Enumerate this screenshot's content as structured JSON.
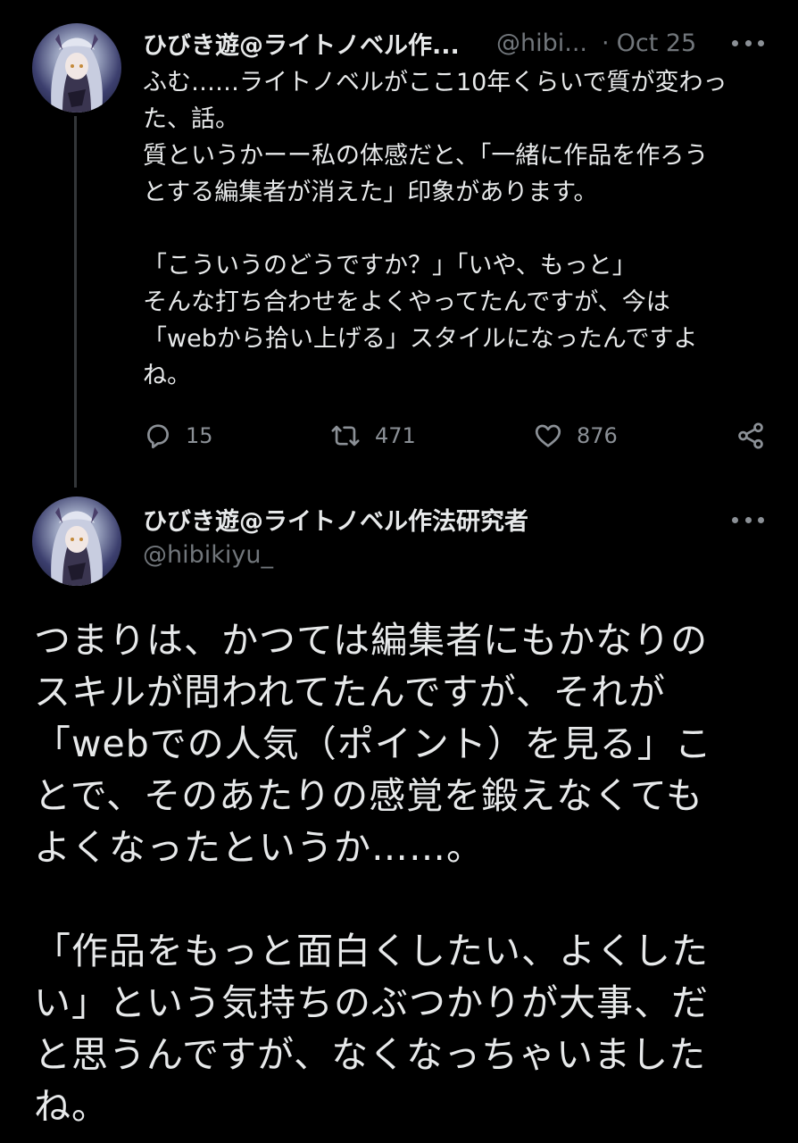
{
  "tweet1": {
    "author_name": "ひびき遊@ライトノベル作...",
    "handle": "@hibi...",
    "separator": "·",
    "date": "Oct 25",
    "more_icon": "more-horizontal-icon",
    "lines": [
      "ふむ……ライトノベルがここ10年くらいで質が変わっ",
      "た、話。",
      "質というかーー私の体感だと、「一緒に作品を作ろう",
      "とする編集者が消えた」印象があります。",
      "",
      "「こういうのどうですか？」「いや、もっと」",
      "そんな打ち合わせをよくやってたんですが、今は",
      "「webから拾い上げる」スタイルになったんですよ",
      "ね。"
    ],
    "actions": {
      "reply_icon": "reply-icon",
      "reply_count": "15",
      "retweet_icon": "retweet-icon",
      "retweet_count": "471",
      "like_icon": "heart-icon",
      "like_count": "876",
      "share_icon": "share-icon"
    }
  },
  "tweet2": {
    "author_name": "ひびき遊@ライトノベル作法研究者",
    "handle": "@hibikiyu_",
    "more_icon": "more-horizontal-icon",
    "lines": [
      "つまりは、かつては編集者にもかなりの",
      "スキルが問われてたんですが、それが",
      "「webでの人気（ポイント）を見る」こ",
      "とで、そのあたりの感覚を鍛えなくても",
      "よくなったというか……。",
      "",
      "「作品をもっと面白くしたい、よくした",
      "い」という気持ちのぶつかりが大事、だ",
      "と思うんですが、なくなっちゃいました",
      "ね。"
    ]
  },
  "colors": {
    "background": "#000000",
    "text": "#e7e9ea",
    "secondary": "#71767b",
    "thread_line": "#333639"
  }
}
